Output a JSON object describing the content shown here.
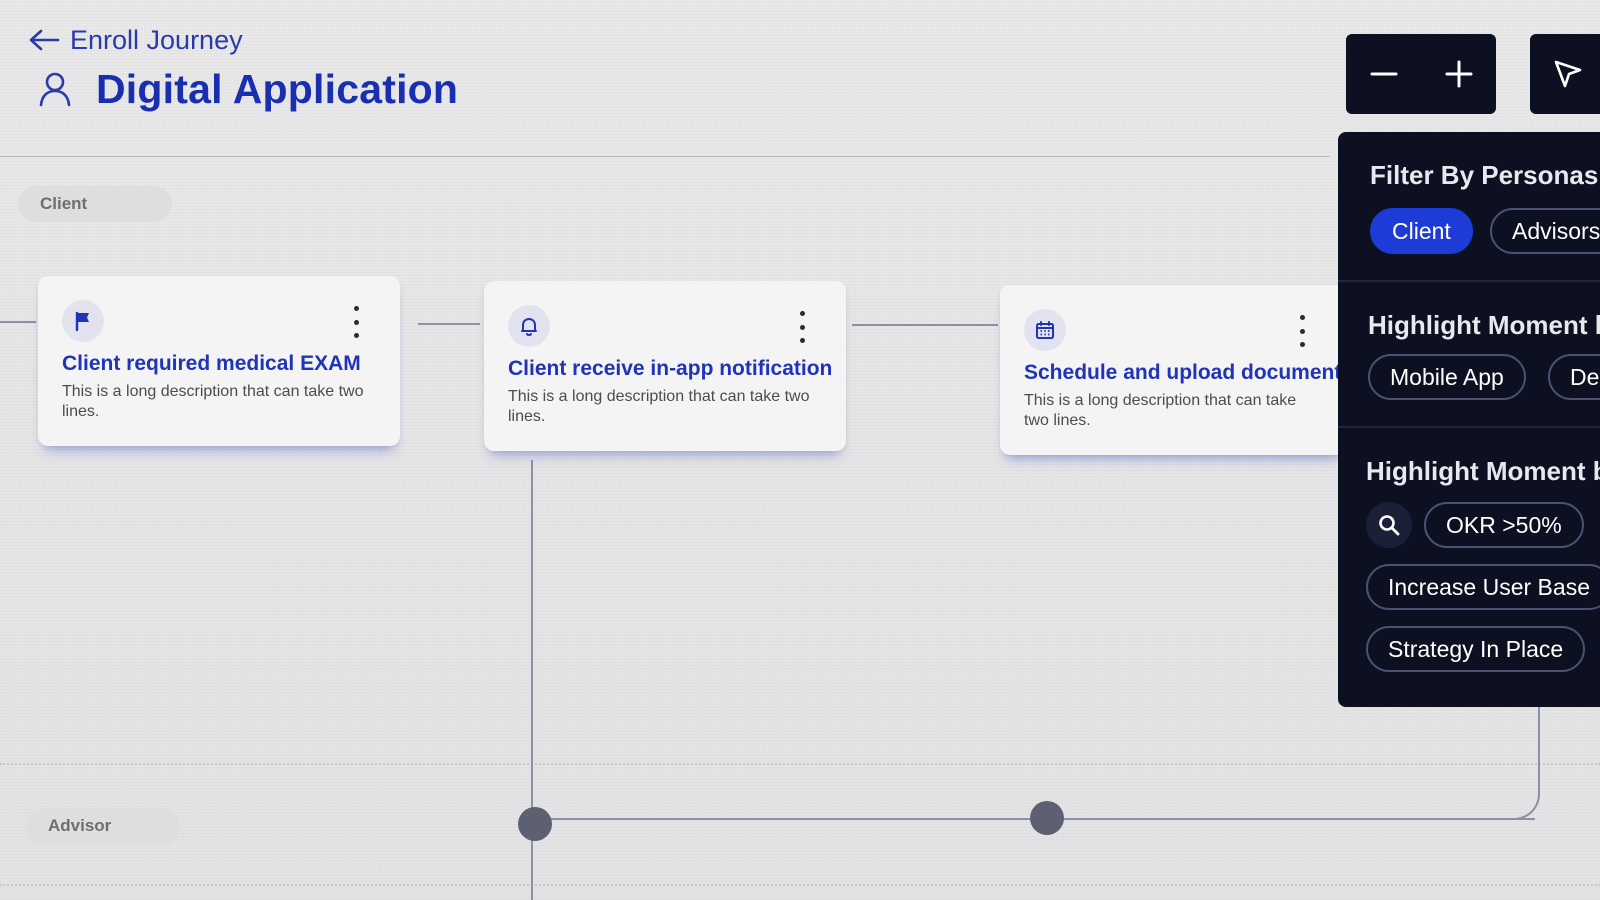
{
  "header": {
    "back_label": "Enroll Journey",
    "page_title": "Digital Application"
  },
  "lanes": {
    "client": "Client",
    "advisor": "Advisor"
  },
  "cards": [
    {
      "icon": "flag-icon",
      "title": "Client required medical EXAM",
      "description": "This is a long description that can take two lines."
    },
    {
      "icon": "bell-icon",
      "title": "Client receive in-app notification",
      "description": "This is a long description that can take two lines."
    },
    {
      "icon": "calendar-icon",
      "title": "Schedule and upload documents",
      "description": "This is a long description that can take two lines."
    }
  ],
  "controls": {
    "zoom_out_icon": "minus-icon",
    "zoom_in_icon": "plus-icon",
    "pointer_icon": "cursor-icon"
  },
  "filter_panel": {
    "personas": {
      "heading": "Filter By Personas",
      "chips": [
        {
          "label": "Client",
          "active": true
        },
        {
          "label": "Advisors",
          "active": false
        }
      ]
    },
    "highlight_channel": {
      "heading": "Highlight Moment b",
      "chips": [
        {
          "label": "Mobile App"
        },
        {
          "label": "Des"
        }
      ]
    },
    "highlight_goal": {
      "heading": "Highlight Moment b",
      "search_icon": "search-icon",
      "chips": [
        {
          "label": "OKR >50%"
        },
        {
          "label": "Increase User Base"
        },
        {
          "label": "Strategy In Place"
        }
      ]
    }
  },
  "colors": {
    "accent": "#1f34b8",
    "panel_bg": "#0d1020",
    "active_chip": "#1d3bd6",
    "connector": "#8b90a6"
  }
}
